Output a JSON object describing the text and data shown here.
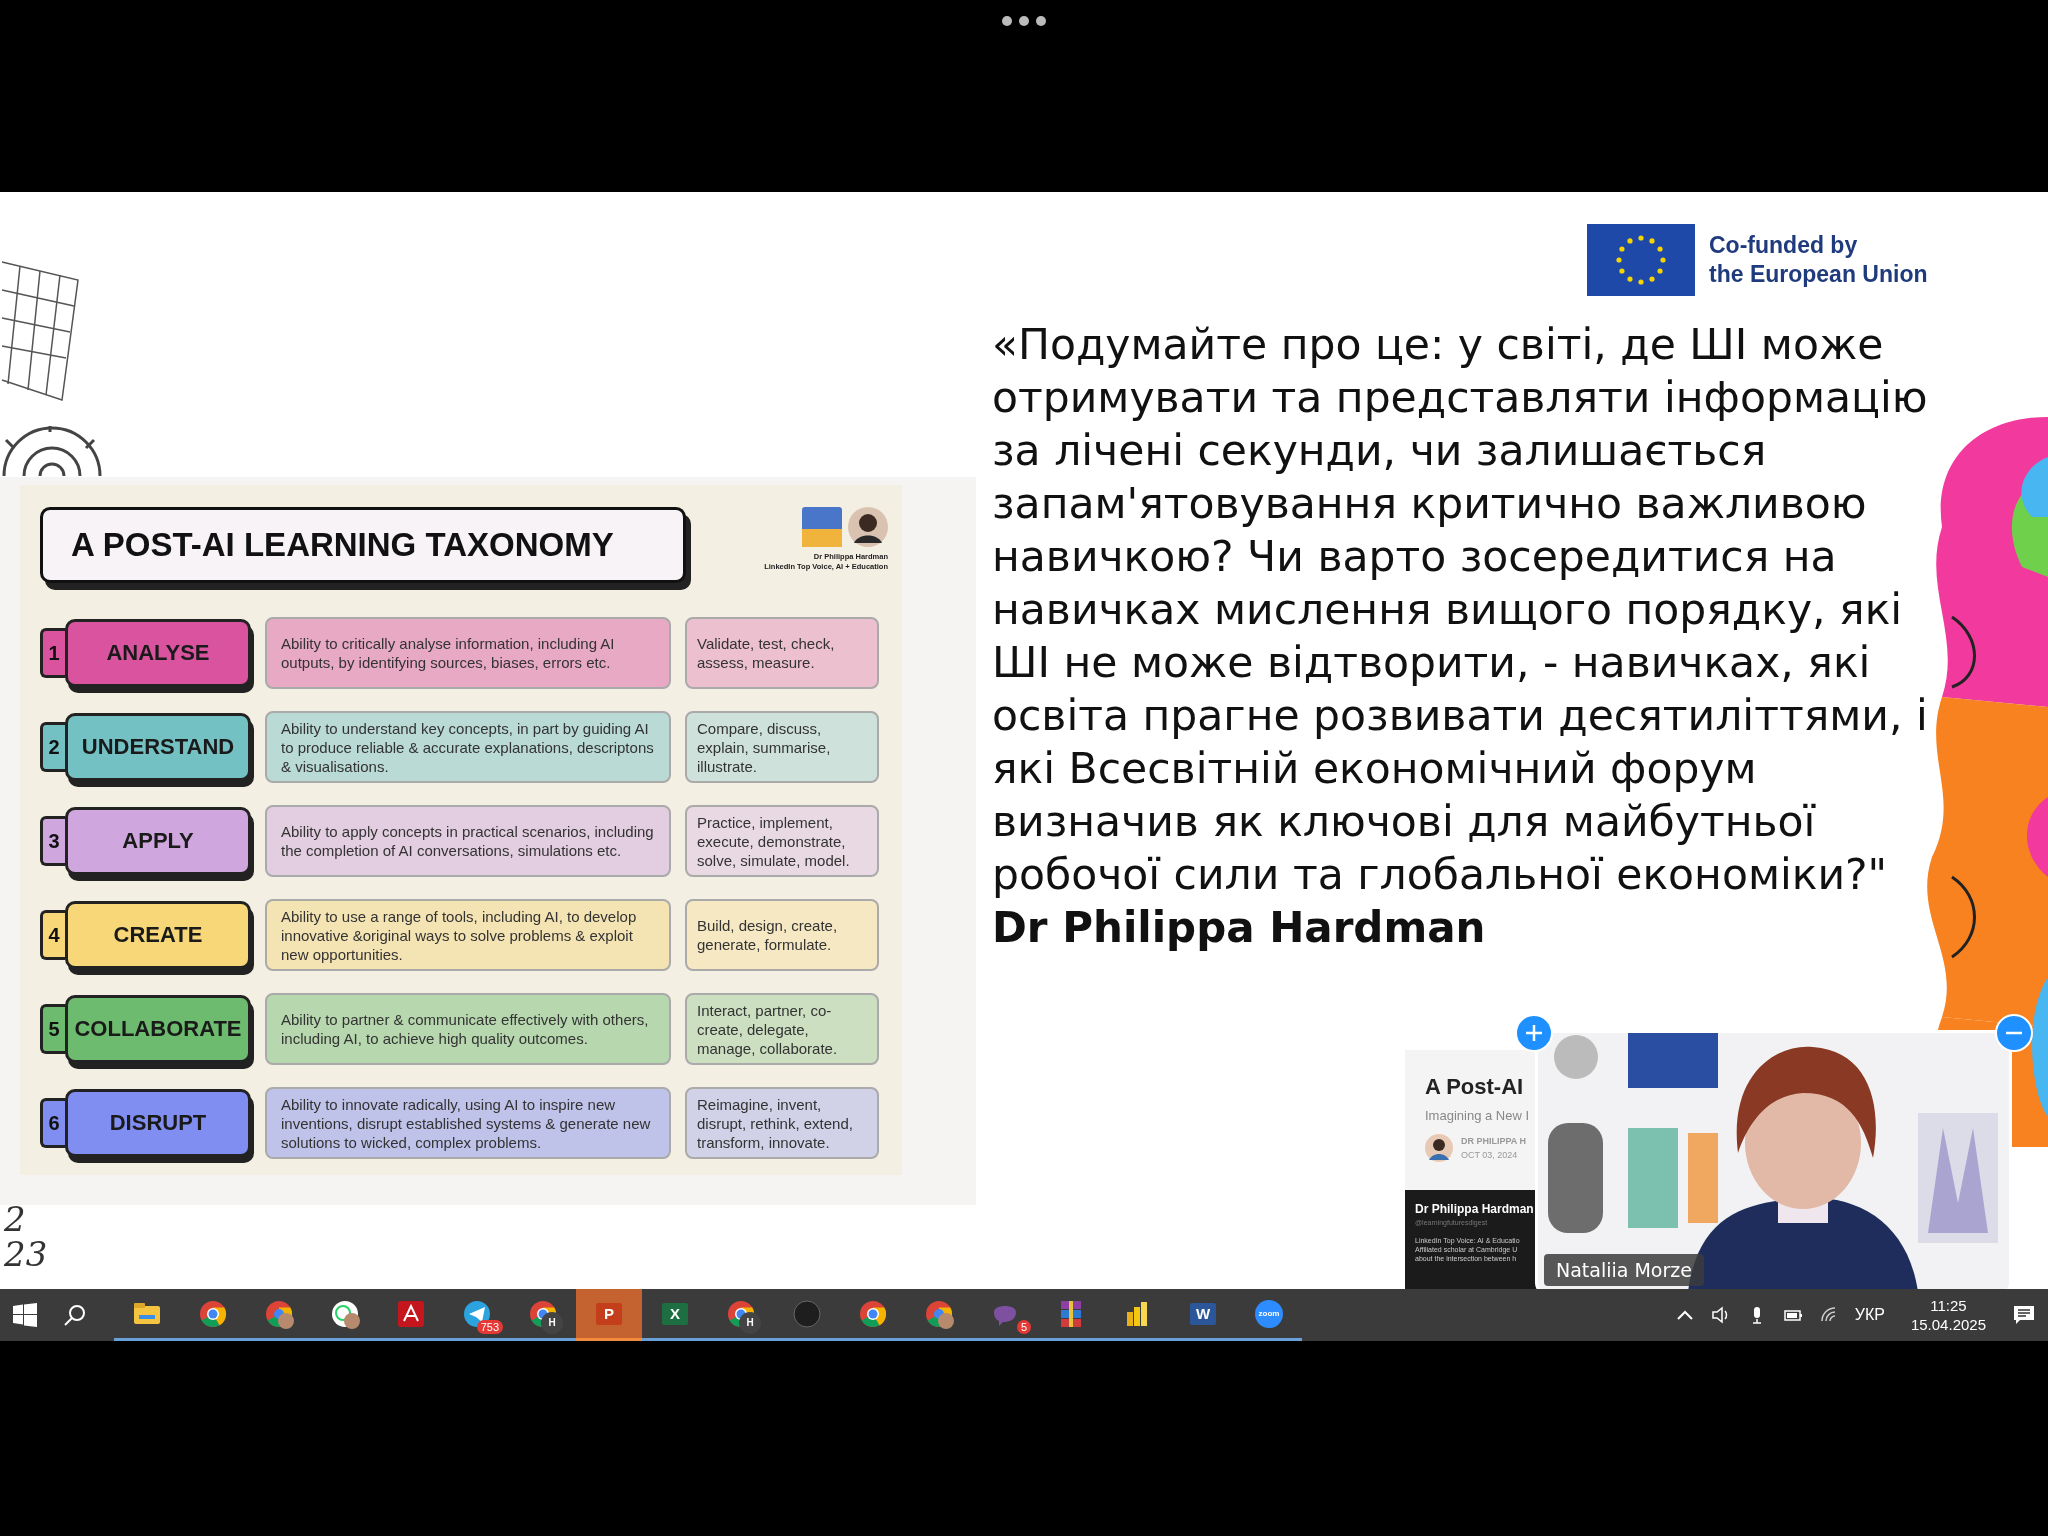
{
  "slide": {
    "eu_label_lines": [
      "Co-funded by",
      "the European Union"
    ],
    "quote": "«Подумайте про це: у світі, де ШІ може отримувати та представляти інформацію за лічені секунди, чи залишається запам'ятовування критично важливою навичкою? Чи варто зосередитися на навичках мислення вищого порядку, які ШІ не може відтворити, - навичках, які освіта прагне розвивати десятиліттями, і які Всесвітній економічний форум визначив як ключові для майбутньої робочої сили та глобальної економіки?\"",
    "author": "Dr Philippa Hardman",
    "handwriting": [
      "2",
      "23"
    ],
    "taxonomy": {
      "title": "A POST-AI LEARNING TAXONOMY",
      "credit_lines": [
        "Dr Philippa Hardman",
        "LinkedIn Top Voice, AI + Education"
      ],
      "rows": [
        {
          "number": "1",
          "name": "ANALYSE",
          "description": "Ability to critically analyse information, including AI outputs, by identifying sources, biases, errors etc.",
          "verbs": "Validate, test, check, assess, measure.",
          "color": "#d9539f"
        },
        {
          "number": "2",
          "name": "UNDERSTAND",
          "description": "Ability to understand key concepts, in part by guiding AI to produce reliable & accurate explanations, descriptons & visualisations.",
          "verbs": "Compare, discuss, explain, summarise, illustrate.",
          "color": "#74c1c4"
        },
        {
          "number": "3",
          "name": "APPLY",
          "description": "Ability to apply concepts in practical scenarios, including the completion of AI conversations, simulations etc.",
          "verbs": "Practice, implement, execute, demonstrate, solve, simulate, model.",
          "color": "#cfa6de"
        },
        {
          "number": "4",
          "name": "CREATE",
          "description": "Ability to use a range of tools, including AI, to develop innovative &original ways to solve problems & exploit new opportunities.",
          "verbs": "Build, design, create, generate, formulate.",
          "color": "#f7d778"
        },
        {
          "number": "5",
          "name": "COLLABORATE",
          "description": "Ability to partner & communicate effectively with others, including AI, to achieve high quality outcomes.",
          "verbs": "Interact, partner, co-create, delegate, manage, collaborate.",
          "color": "#6dbb6f"
        },
        {
          "number": "6",
          "name": "DISRUPT",
          "description": "Ability to innovate radically, using AI to inspire new inventions, disrupt established systems & generate new solutions to wicked, complex problems.",
          "verbs": "Reimagine, invent, disrupt, rethink, extend, transform, innovate.",
          "color": "#7f8ef0"
        }
      ]
    }
  },
  "article_preview": {
    "title": "A Post-AI",
    "subtitle": "Imagining a New I",
    "author": "DR PHILIPPA H",
    "date": "OCT 03, 2024",
    "name": "Dr Philippa Hardman",
    "handle": "@learningfuturesdigest",
    "bio_lines": [
      "LinkedIn Top Voice: AI & Educatio",
      "Affiliated scholar at Cambridge U",
      "about the intersection between h"
    ]
  },
  "video": {
    "participant": "Nataliia Morze"
  },
  "taskbar": {
    "apps": [
      {
        "kind": "explorer",
        "selected": false
      },
      {
        "kind": "chrome",
        "selected": false
      },
      {
        "kind": "chrome-profile",
        "selected": false
      },
      {
        "kind": "whatsapp",
        "selected": false
      },
      {
        "kind": "acrobat",
        "selected": false
      },
      {
        "kind": "telegram",
        "badge": "753",
        "selected": false
      },
      {
        "kind": "chrome",
        "letter": "H",
        "selected": false
      },
      {
        "kind": "powerpoint",
        "letter": "P",
        "selected": true
      },
      {
        "kind": "excel",
        "letter": "X",
        "selected": false
      },
      {
        "kind": "chrome",
        "letter": "H",
        "selected": false
      },
      {
        "kind": "dark-circle",
        "selected": false
      },
      {
        "kind": "chrome",
        "selected": false
      },
      {
        "kind": "chrome-profile",
        "selected": false
      },
      {
        "kind": "viber",
        "badge": "5",
        "selected": false
      },
      {
        "kind": "winrar",
        "selected": false
      },
      {
        "kind": "powerbi",
        "selected": false
      },
      {
        "kind": "word",
        "letter": "W",
        "selected": false
      },
      {
        "kind": "zoom",
        "letter": "zoom",
        "selected": false
      }
    ],
    "tray": {
      "language": "УКР",
      "time": "11:25",
      "date": "15.04.2025"
    }
  }
}
